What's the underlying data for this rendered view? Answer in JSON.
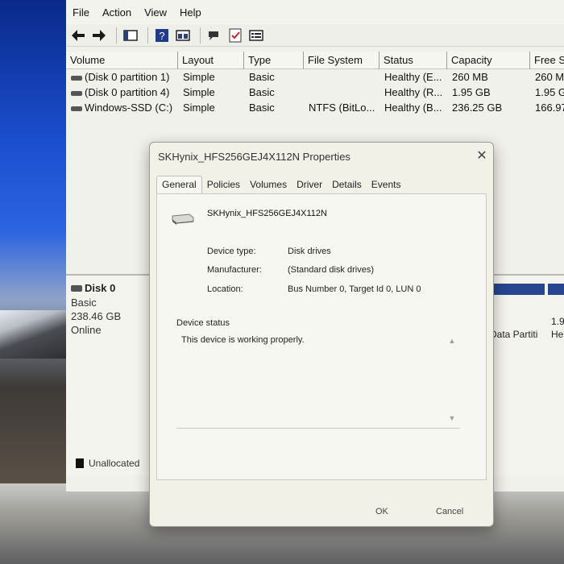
{
  "menubar": {
    "items": [
      "File",
      "Action",
      "View",
      "Help"
    ]
  },
  "toolbar": {
    "icons": [
      "back-arrow-icon",
      "forward-arrow-icon",
      "console-tree-icon",
      "help-icon",
      "properties-icon",
      "connect-icon",
      "checklist-icon",
      "volume-list-icon"
    ]
  },
  "volume_table": {
    "columns": [
      "Volume",
      "Layout",
      "Type",
      "File System",
      "Status",
      "Capacity",
      "Free S"
    ],
    "rows": [
      [
        "(Disk 0 partition 1)",
        "Simple",
        "Basic",
        "",
        "Healthy (E...",
        "260 MB",
        "260 M"
      ],
      [
        "(Disk 0 partition 4)",
        "Simple",
        "Basic",
        "",
        "Healthy (R...",
        "1.95 GB",
        "1.95 G"
      ],
      [
        "Windows-SSD (C:)",
        "Simple",
        "Basic",
        "NTFS (BitLo...",
        "Healthy (B...",
        "236.25 GB",
        "166.97"
      ]
    ]
  },
  "disk_graph": {
    "disk_name": "Disk 0",
    "disk_type": "Basic",
    "disk_size": "238.46 GB",
    "disk_status": "Online",
    "partition_text_1": "Data Partiti",
    "partition_text_2a": "1.9",
    "partition_text_2b": "He",
    "legend_unallocated": "Unallocated",
    "partition_color": "#27468f"
  },
  "dialog": {
    "title": "SKHynix_HFS256GEJ4X112N Properties",
    "tabs": [
      "General",
      "Policies",
      "Volumes",
      "Driver",
      "Details",
      "Events"
    ],
    "active_tab": "General",
    "device_name": "SKHynix_HFS256GEJ4X112N",
    "device_type_label": "Device type:",
    "device_type_value": "Disk drives",
    "manufacturer_label": "Manufacturer:",
    "manufacturer_value": "(Standard disk drives)",
    "location_label": "Location:",
    "location_value": "Bus Number 0, Target Id 0, LUN 0",
    "status_caption": "Device status",
    "status_text": "This device is working properly.",
    "ok_label": "OK",
    "cancel_label": "Cancel",
    "close_symbol": "✕"
  }
}
